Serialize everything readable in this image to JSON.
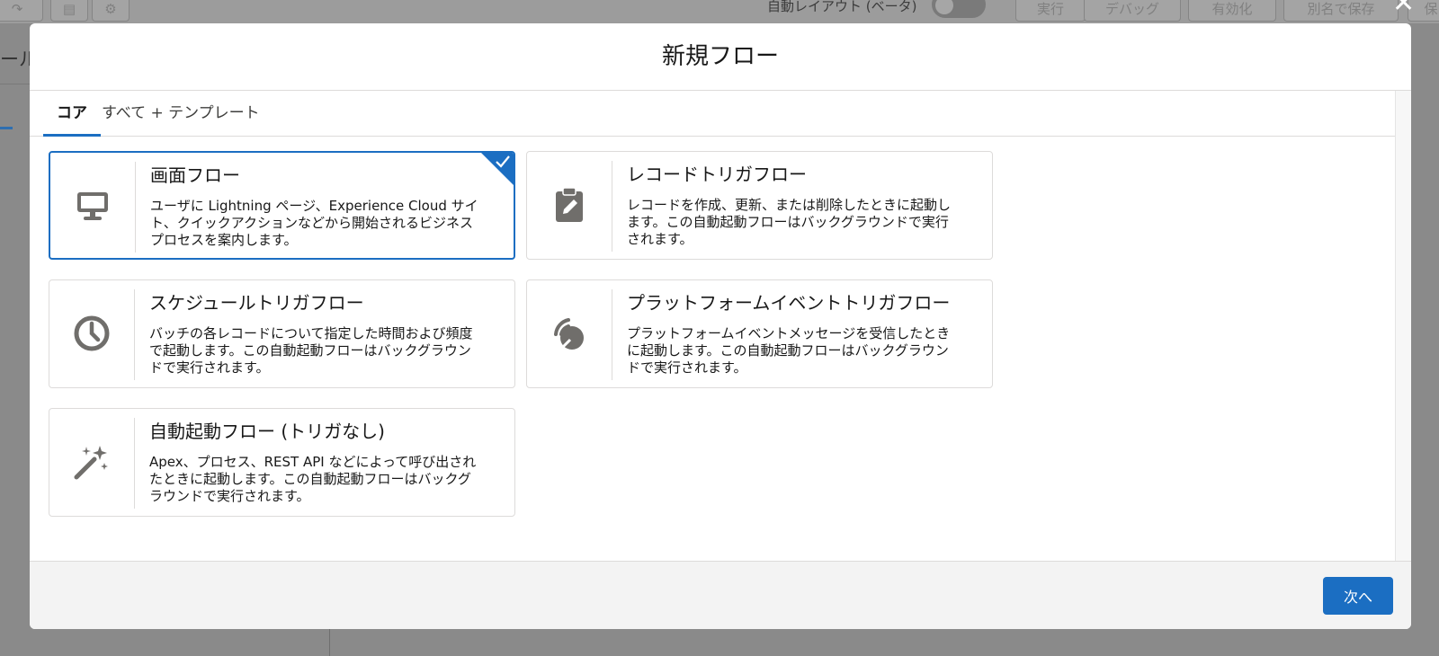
{
  "background": {
    "toolbar_buttons": [
      "実行",
      "デバッグ",
      "有効化",
      "別名で保存",
      "保"
    ],
    "auto_layout_label": "自動レイアウト (ベータ)",
    "side_text": "ール",
    "colors": {
      "overlay": "#8a8a8a"
    }
  },
  "modal": {
    "title": "新規フロー",
    "tabs": [
      {
        "label": "コア",
        "active": true
      },
      {
        "label": "すべて + テンプレート",
        "active": false
      }
    ],
    "cards": [
      {
        "title": "画面フロー",
        "description": "ユーザに Lightning ページ、Experience Cloud サイト、クイックアクションなどから開始されるビジネスプロセスを案内します。",
        "icon": "desktop-icon",
        "selected": true
      },
      {
        "title": "レコードトリガフロー",
        "description": "レコードを作成、更新、または削除したときに起動します。この自動起動フローはバックグラウンドで実行されます。",
        "icon": "clipboard-edit-icon",
        "selected": false
      },
      {
        "title": "スケジュールトリガフロー",
        "description": "バッチの各レコードについて指定した時間および頻度で起動します。この自動起動フローはバックグラウンドで実行されます。",
        "icon": "clock-icon",
        "selected": false
      },
      {
        "title": "プラットフォームイベントトリガフロー",
        "description": "プラットフォームイベントメッセージを受信したときに起動します。この自動起動フローはバックグラウンドで実行されます。",
        "icon": "signal-icon",
        "selected": false
      },
      {
        "title": "自動起動フロー (トリガなし)",
        "description": "Apex、プロセス、REST API などによって呼び出されたときに起動します。この自動起動フローはバックグラウンドで実行されます。",
        "icon": "magic-wand-icon",
        "selected": false
      }
    ],
    "next_label": "次へ",
    "colors": {
      "brand": "#1b6ec2",
      "icon": "#706e6b",
      "border": "#dddbda"
    }
  }
}
